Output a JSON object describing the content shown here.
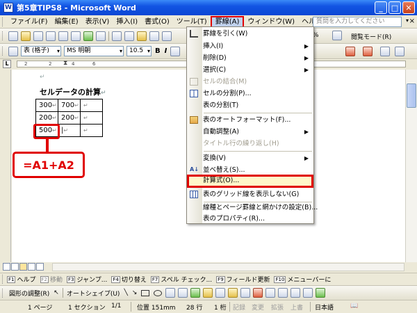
{
  "window": {
    "title": "第5章TIPS8 - Microsoft Word",
    "controls": [
      "_",
      "□",
      "✕"
    ]
  },
  "menubar": {
    "items": [
      "ファイル(F)",
      "編集(E)",
      "表示(V)",
      "挿入(I)",
      "書式(O)",
      "ツール(T)",
      "罫線(A)",
      "ウィンドウ(W)",
      "ヘルプ(H)"
    ],
    "active_index": 6,
    "help_placeholder": "質問を入力してください",
    "close_doc": "×"
  },
  "toolbar1": {
    "zoom": "%",
    "reading_mode": "閲覧モード(R)"
  },
  "toolbar2": {
    "style": "表 (格子)",
    "font": "MS 明朝",
    "size": "10.5",
    "bold": "B",
    "italic": "I"
  },
  "ruler": {
    "corner": "L",
    "ticks": [
      "2",
      "2",
      "4",
      "6"
    ]
  },
  "document": {
    "heading": "セルデータの計算",
    "para_mark": "↵",
    "table": [
      [
        "300",
        "700",
        ""
      ],
      [
        "200",
        "200",
        ""
      ],
      [
        "500",
        "",
        ""
      ]
    ],
    "cell_mark": "↵"
  },
  "callout": {
    "formula": "=A1+A2"
  },
  "menu": {
    "items": [
      {
        "label": "罫線を引く(W)",
        "arrow": false,
        "disabled": false,
        "icon": true
      },
      {
        "label": "挿入(I)",
        "arrow": true,
        "disabled": false,
        "icon": false
      },
      {
        "label": "削除(D)",
        "arrow": true,
        "disabled": false,
        "icon": false
      },
      {
        "label": "選択(C)",
        "arrow": true,
        "disabled": false,
        "icon": false
      },
      {
        "label": "セルの結合(M)",
        "arrow": false,
        "disabled": true,
        "icon": true
      },
      {
        "label": "セルの分割(P)...",
        "arrow": false,
        "disabled": false,
        "icon": true
      },
      {
        "label": "表の分割(T)",
        "arrow": false,
        "disabled": false,
        "icon": false
      },
      {
        "label": "表のオートフォーマット(F)...",
        "arrow": false,
        "disabled": false,
        "icon": true
      },
      {
        "label": "自動調整(A)",
        "arrow": true,
        "disabled": false,
        "icon": false
      },
      {
        "label": "タイトル行の繰り返し(H)",
        "arrow": false,
        "disabled": true,
        "icon": false
      },
      {
        "label": "変換(V)",
        "arrow": true,
        "disabled": false,
        "icon": false
      },
      {
        "label": "並べ替え(S)...",
        "arrow": false,
        "disabled": false,
        "icon": true
      },
      {
        "label": "計算式(O)...",
        "arrow": false,
        "disabled": false,
        "icon": false
      },
      {
        "label": "表のグリッド線を表示しない(G)",
        "arrow": false,
        "disabled": false,
        "icon": true
      },
      {
        "label": "線種とページ罫線と網かけの設定(B)...",
        "arrow": false,
        "disabled": false,
        "icon": false
      },
      {
        "label": "表のプロパティ(R)...",
        "arrow": false,
        "disabled": false,
        "icon": false
      }
    ],
    "highlight_index": 12
  },
  "fnbar": {
    "keys": [
      {
        "key": "F1",
        "label": "ヘルプ"
      },
      {
        "key": "F2",
        "label": "移動"
      },
      {
        "key": "F3",
        "label": "ジャンプ..."
      },
      {
        "key": "F4",
        "label": "切り替え"
      },
      {
        "key": "F7",
        "label": "スペル チェック..."
      },
      {
        "key": "F9",
        "label": "フィールド更新"
      },
      {
        "key": "F10",
        "label": "メニューバーに"
      }
    ]
  },
  "drawbar": {
    "draw_label": "図形の調整(R)",
    "autoshape_label": "オートシェイプ(U)"
  },
  "statusbar": {
    "page": "1 ページ",
    "section": "1 セクション",
    "pages": "1/1",
    "position": "位置 151mm",
    "line": "28 行",
    "col": "1 桁",
    "rec": "記録",
    "trk": "変更",
    "ext": "拡張",
    "ovr": "上書",
    "lang": "日本語"
  },
  "colors": {
    "highlight_red": "#e00000",
    "title_blue": "#0a46d4"
  }
}
